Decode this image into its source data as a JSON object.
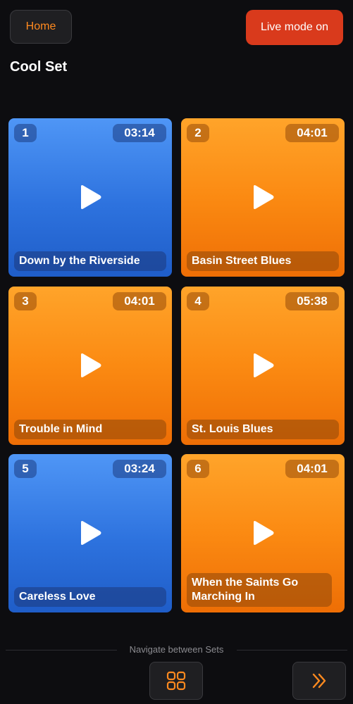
{
  "header": {
    "home_label": "Home",
    "live_label": "Live mode on",
    "set_title": "Cool Set"
  },
  "songs": [
    {
      "number": "1",
      "duration": "03:14",
      "title": "Down by the Riverside",
      "color": "#2d72de"
    },
    {
      "number": "2",
      "duration": "04:01",
      "title": "Basin Street Blues",
      "color": "#fb8a12"
    },
    {
      "number": "3",
      "duration": "04:01",
      "title": "Trouble in Mind",
      "color": "#fb8a12"
    },
    {
      "number": "4",
      "duration": "05:38",
      "title": "St. Louis Blues",
      "color": "#fb8a12"
    },
    {
      "number": "5",
      "duration": "03:24",
      "title": "Careless Love",
      "color": "#2d72de"
    },
    {
      "number": "6",
      "duration": "04:01",
      "title": "When the Saints Go Marching In",
      "color": "#fb8a12"
    }
  ],
  "footer": {
    "navigate_label": "Navigate between Sets",
    "grid_icon": "grid-icon",
    "next_icon": "chevron-double-right-icon"
  },
  "colors": {
    "accent": "#ff8a1f",
    "live": "#d93a1c",
    "background": "#0d0d10"
  }
}
